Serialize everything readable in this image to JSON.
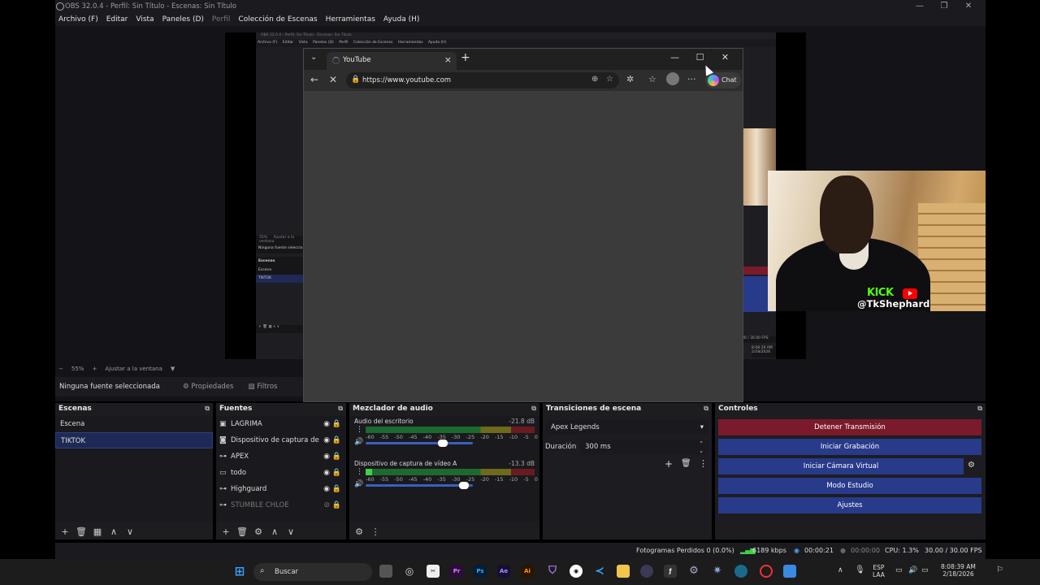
{
  "window": {
    "title": "OBS 32.0.4 - Perfil: Sin Título - Escenas: Sin Título",
    "controls": [
      "—",
      "❐",
      "✕"
    ]
  },
  "menu": [
    "Archivo (F)",
    "Editar",
    "Vista",
    "Paneles (D)",
    "Perfil",
    "Colección de Escenas",
    "Herramientas",
    "Ayuda (H)"
  ],
  "nested": {
    "title": "OBS 32.0.4 - Perfil: Sin Título - Escenas: Sin Título",
    "menu": [
      "Archivo (F)",
      "Editar",
      "Vista",
      "Paneles (D)",
      "Perfil",
      "Colección de Escenas",
      "Herramientas",
      "Ayuda (H)"
    ],
    "zoom": "55%",
    "fit": "Ajustar a la ventana",
    "no_source": "Ninguna fuente seleccio",
    "scenes_title": "Escenas",
    "scenes": [
      "Escena",
      "TIKTOK"
    ],
    "fps": "00 / 30.00 FPS",
    "time": "8:08:39 AM",
    "date": "2/18/2026"
  },
  "browser": {
    "tab_title": "YouTube",
    "url": "https://www.youtube.com",
    "chat_label": "Chat"
  },
  "overlay": {
    "kick_label": "KICK",
    "handle": "@TkShephard"
  },
  "preview_bar": {
    "zoom": "55%",
    "fit": "Ajustar a la ventana"
  },
  "context_bar": {
    "no_source": "Ninguna fuente seleccionada",
    "properties": "Propiedades",
    "filters": "Filtros"
  },
  "scenes": {
    "title": "Escenas",
    "items": [
      "Escena",
      "TIKTOK"
    ],
    "selected": "TIKTOK"
  },
  "sources": {
    "title": "Fuentes",
    "items": [
      {
        "name": "LAGRIMA",
        "icon": "image-icon",
        "visible": true
      },
      {
        "name": "Dispositivo de captura de",
        "icon": "camera-icon",
        "visible": true
      },
      {
        "name": "APEX",
        "icon": "gamepad-icon",
        "visible": true
      },
      {
        "name": "todo",
        "icon": "monitor-icon",
        "visible": true
      },
      {
        "name": "Highguard",
        "icon": "gamepad-icon",
        "visible": true
      },
      {
        "name": "STUMBLE CHLOE",
        "icon": "gamepad-icon",
        "visible": false
      }
    ]
  },
  "mixer": {
    "title": "Mezclador de audio",
    "scale": [
      "-60",
      "-55",
      "-50",
      "-45",
      "-40",
      "-35",
      "-30",
      "-25",
      "-20",
      "-15",
      "-10",
      "-5",
      "0"
    ],
    "channels": [
      {
        "name": "Audio del escritorio",
        "db": "-21.8 dB",
        "level": 0.0,
        "volume": 0.72
      },
      {
        "name": "Dispositivo de captura de vídeo A",
        "db": "-13.3 dB",
        "level": 0.04,
        "volume": 0.92
      }
    ]
  },
  "transitions": {
    "title": "Transiciones de escena",
    "selected": "Apex Legends",
    "duration_label": "Duración",
    "duration_value": "300 ms"
  },
  "controls": {
    "title": "Controles",
    "buttons": [
      "Detener Transmisión",
      "Iniciar Grabación",
      "Iniciar Cámara Virtual",
      "Modo Estudio",
      "Ajustes"
    ],
    "colors": {
      "stop": "#7a1a2a",
      "normal": "#283a8a"
    }
  },
  "status": {
    "dropped": "Fotogramas Perdidos 0 (0.0%)",
    "bitrate": "6189 kbps",
    "stream_time": "00:00:21",
    "rec_time": "00:00:00",
    "cpu": "CPU: 1.3%",
    "fps": "30.00 / 30.00 FPS"
  },
  "taskbar": {
    "search": "Buscar",
    "lang_top": "ESP",
    "lang_bottom": "LAA",
    "time": "8:08:39 AM",
    "date": "2/18/2026",
    "apps": [
      "Pr",
      "Ps",
      "Ae",
      "Ai"
    ]
  }
}
